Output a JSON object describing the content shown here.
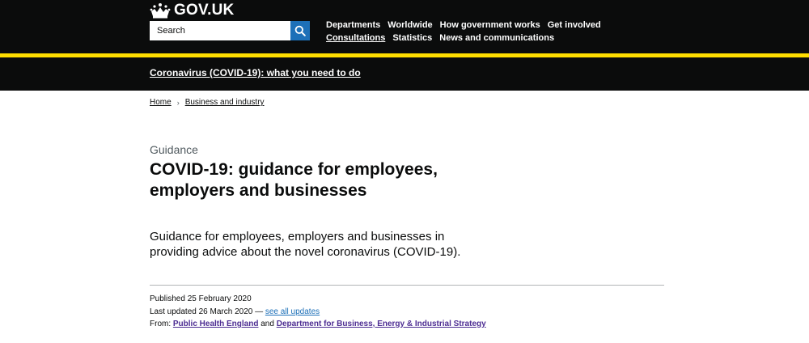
{
  "header": {
    "logo_text": "GOV.UK",
    "search_placeholder": "Search",
    "nav_row1": [
      "Departments",
      "Worldwide",
      "How government works",
      "Get involved"
    ],
    "nav_row2": [
      "Consultations",
      "Statistics",
      "News and communications"
    ],
    "active_nav": "Consultations"
  },
  "banner": {
    "link_text": "Coronavirus (COVID-19): what you need to do"
  },
  "breadcrumb": {
    "items": [
      "Home",
      "Business and industry"
    ]
  },
  "page": {
    "caption": "Guidance",
    "title": "COVID-19: guidance for employees, employers and businesses",
    "summary": "Guidance for employees, employers and businesses in providing advice about the novel coronavirus (COVID-19)."
  },
  "meta": {
    "published": "Published 25 February 2020",
    "last_updated": "Last updated 26 March 2020 —",
    "see_all_updates": "see all updates",
    "from_label": "From:",
    "org1": "Public Health England",
    "and": "and",
    "org2": "Department for Business, Energy & Industrial Strategy"
  },
  "colors": {
    "header_bg": "#0b0c0c",
    "accent_yellow": "#ffdd00",
    "link_blue": "#1d70b8",
    "org_link": "#4c2c92",
    "secondary_text": "#505a5f"
  },
  "icons": {
    "logo": "crown-icon",
    "search": "search-icon",
    "breadcrumb_separator": "chevron-right-icon"
  }
}
